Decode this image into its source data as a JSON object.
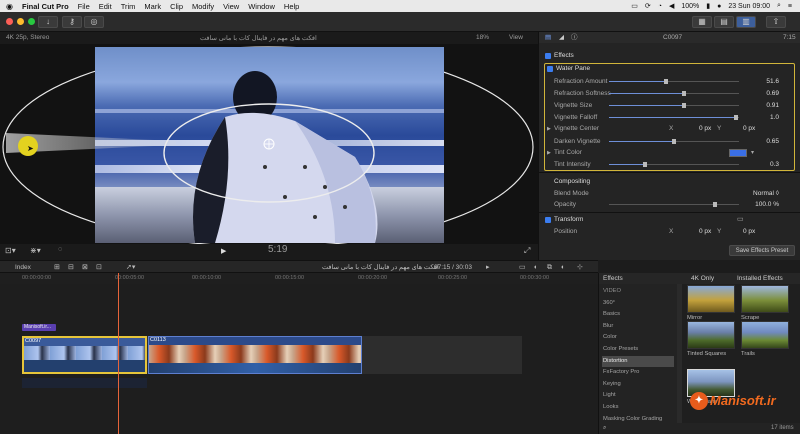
{
  "menubar": {
    "apple": "",
    "app": "Final Cut Pro",
    "items": [
      "File",
      "Edit",
      "Trim",
      "Mark",
      "Clip",
      "Modify",
      "View",
      "Window",
      "Help"
    ],
    "battery": "100%",
    "date": "23 Sun 09:00"
  },
  "viewer": {
    "format": "4K 25p, Stereo",
    "title": "افکت های مهم در فاینال کات با مانی سافت",
    "zoom": "18%",
    "view_label": "View",
    "timecode": "5:19"
  },
  "inspector": {
    "clip": "C0097",
    "duration": "7:15",
    "sections": {
      "effects": "Effects",
      "water_pane": "Water Pane",
      "compositing": "Compositing",
      "transform": "Transform"
    },
    "params": [
      {
        "label": "Refraction Amount",
        "value": "51.6",
        "pos": 0.44
      },
      {
        "label": "Refraction Softness",
        "value": "0.69",
        "pos": 0.58
      },
      {
        "label": "Vignette Size",
        "value": "0.91",
        "pos": 0.58
      },
      {
        "label": "Vignette Falloff",
        "value": "1.0",
        "pos": 0.98
      },
      {
        "label": "Vignette Center",
        "value": ""
      },
      {
        "label": "Darken Vignette",
        "value": "0.65",
        "pos": 0.5
      },
      {
        "label": "Tint Color",
        "value": ""
      },
      {
        "label": "Tint Intensity",
        "value": "0.3",
        "pos": 0.28
      }
    ],
    "center": {
      "x": "0 px",
      "y": "0 px",
      "xl": "X",
      "yl": "Y"
    },
    "blend_label": "Blend Mode",
    "blend_value": "Normal ◊",
    "opacity_label": "Opacity",
    "opacity_value": "100.0 %",
    "position_label": "Position",
    "position": {
      "xl": "X",
      "x": "0 px",
      "yl": "Y",
      "y": "0 px"
    },
    "save_preset": "Save Effects Preset",
    "tint_color": "#3a6fe6"
  },
  "timeline": {
    "index": "Index",
    "project": "افکت های مهم در فاینال کات با مانی سافت",
    "timecode": "07:15 / 30:03",
    "ruler": [
      "00:00:00:00",
      "00:00:05:00",
      "00:00:10:00",
      "00:00:15:00",
      "00:00:20:00",
      "00:00:25:00",
      "00:00:30:00"
    ],
    "title_clip": "Manisoft.ir...",
    "clip1": "C0097",
    "clip2": "C0113"
  },
  "browser": {
    "header": "Effects",
    "filter": "4K Only",
    "installed": "Installed Effects",
    "categories": [
      "VIDEO",
      "360°",
      "Basics",
      "Blur",
      "Color",
      "Color Presets",
      "Distortion",
      "FxFactory Pro",
      "Keying",
      "Light",
      "Looks",
      "Masking Color Grading"
    ],
    "selected": "Distortion",
    "thumbs": [
      {
        "label": "Mirror"
      },
      {
        "label": "Scrape"
      },
      {
        "label": "Tinted Squares"
      },
      {
        "label": "Trails"
      },
      {
        "label": "Water Pane"
      }
    ],
    "count": "17 items"
  },
  "watermark": "Manisoft.ir"
}
